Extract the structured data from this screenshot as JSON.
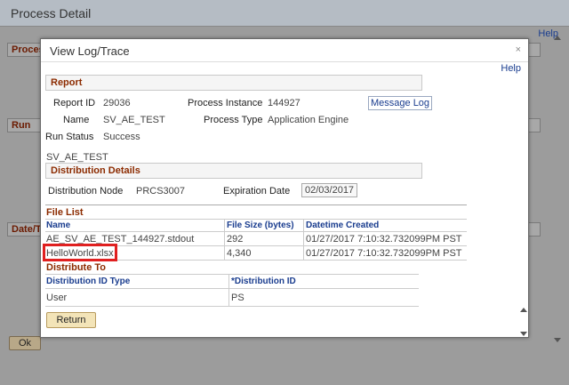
{
  "background": {
    "title": "Process Detail",
    "help": "Help",
    "sections": [
      "Proces",
      "Run",
      "Date/T"
    ],
    "ok_label": "Ok"
  },
  "modal": {
    "title": "View Log/Trace",
    "close": "×",
    "help": "Help",
    "report": {
      "section_title": "Report",
      "report_id_label": "Report ID",
      "report_id": "29036",
      "process_instance_label": "Process Instance",
      "process_instance": "144927",
      "message_log": "Message Log",
      "name_label": "Name",
      "name": "SV_AE_TEST",
      "process_type_label": "Process Type",
      "process_type": "Application Engine",
      "run_status_label": "Run Status",
      "run_status": "Success",
      "description": "SV_AE_TEST"
    },
    "distribution": {
      "section_title": "Distribution Details",
      "node_label": "Distribution Node",
      "node": "PRCS3007",
      "expiration_label": "Expiration Date",
      "expiration": "02/03/2017"
    },
    "file_list": {
      "title": "File List",
      "columns": [
        "Name",
        "File Size (bytes)",
        "Datetime Created"
      ],
      "rows": [
        {
          "name": "AE_SV_AE_TEST_144927.stdout",
          "size": "292",
          "created": "01/27/2017  7:10:32.732099PM PST"
        },
        {
          "name": "HelloWorld.xlsx",
          "size": "4,340",
          "created": "01/27/2017  7:10:32.732099PM PST"
        }
      ]
    },
    "distribute_to": {
      "title": "Distribute To",
      "columns": [
        "Distribution ID Type",
        "*Distribution ID"
      ],
      "rows": [
        {
          "type": "User",
          "id": "PS"
        }
      ]
    },
    "return_label": "Return"
  },
  "colors": {
    "section_title": "#8c2b00",
    "link": "#1a3d8f",
    "highlight": "#e02020",
    "button_bg": "#f3e4b8"
  }
}
